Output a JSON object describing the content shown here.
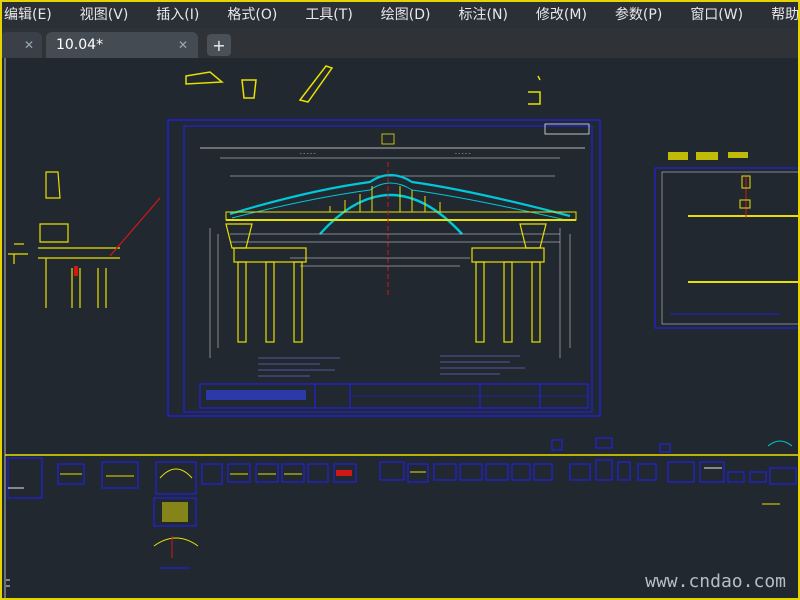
{
  "menu": {
    "items": [
      {
        "label": "编辑(E)"
      },
      {
        "label": "视图(V)"
      },
      {
        "label": "插入(I)"
      },
      {
        "label": "格式(O)"
      },
      {
        "label": "工具(T)"
      },
      {
        "label": "绘图(D)"
      },
      {
        "label": "标注(N)"
      },
      {
        "label": "修改(M)"
      },
      {
        "label": "参数(P)"
      },
      {
        "label": "窗口(W)"
      },
      {
        "label": "帮助"
      }
    ]
  },
  "tabs": {
    "active_label": "10.04*",
    "close_icon": "close-icon",
    "plus_label": "+"
  },
  "watermark": {
    "text": "www.cndao.com"
  },
  "colors": {
    "background": "#212830",
    "drawing_yellow": "#e8e000",
    "drawing_blue": "#2020ff",
    "drawing_cyan": "#00c8d8",
    "drawing_red": "#d01818",
    "frame_yellow": "#e6d400"
  }
}
